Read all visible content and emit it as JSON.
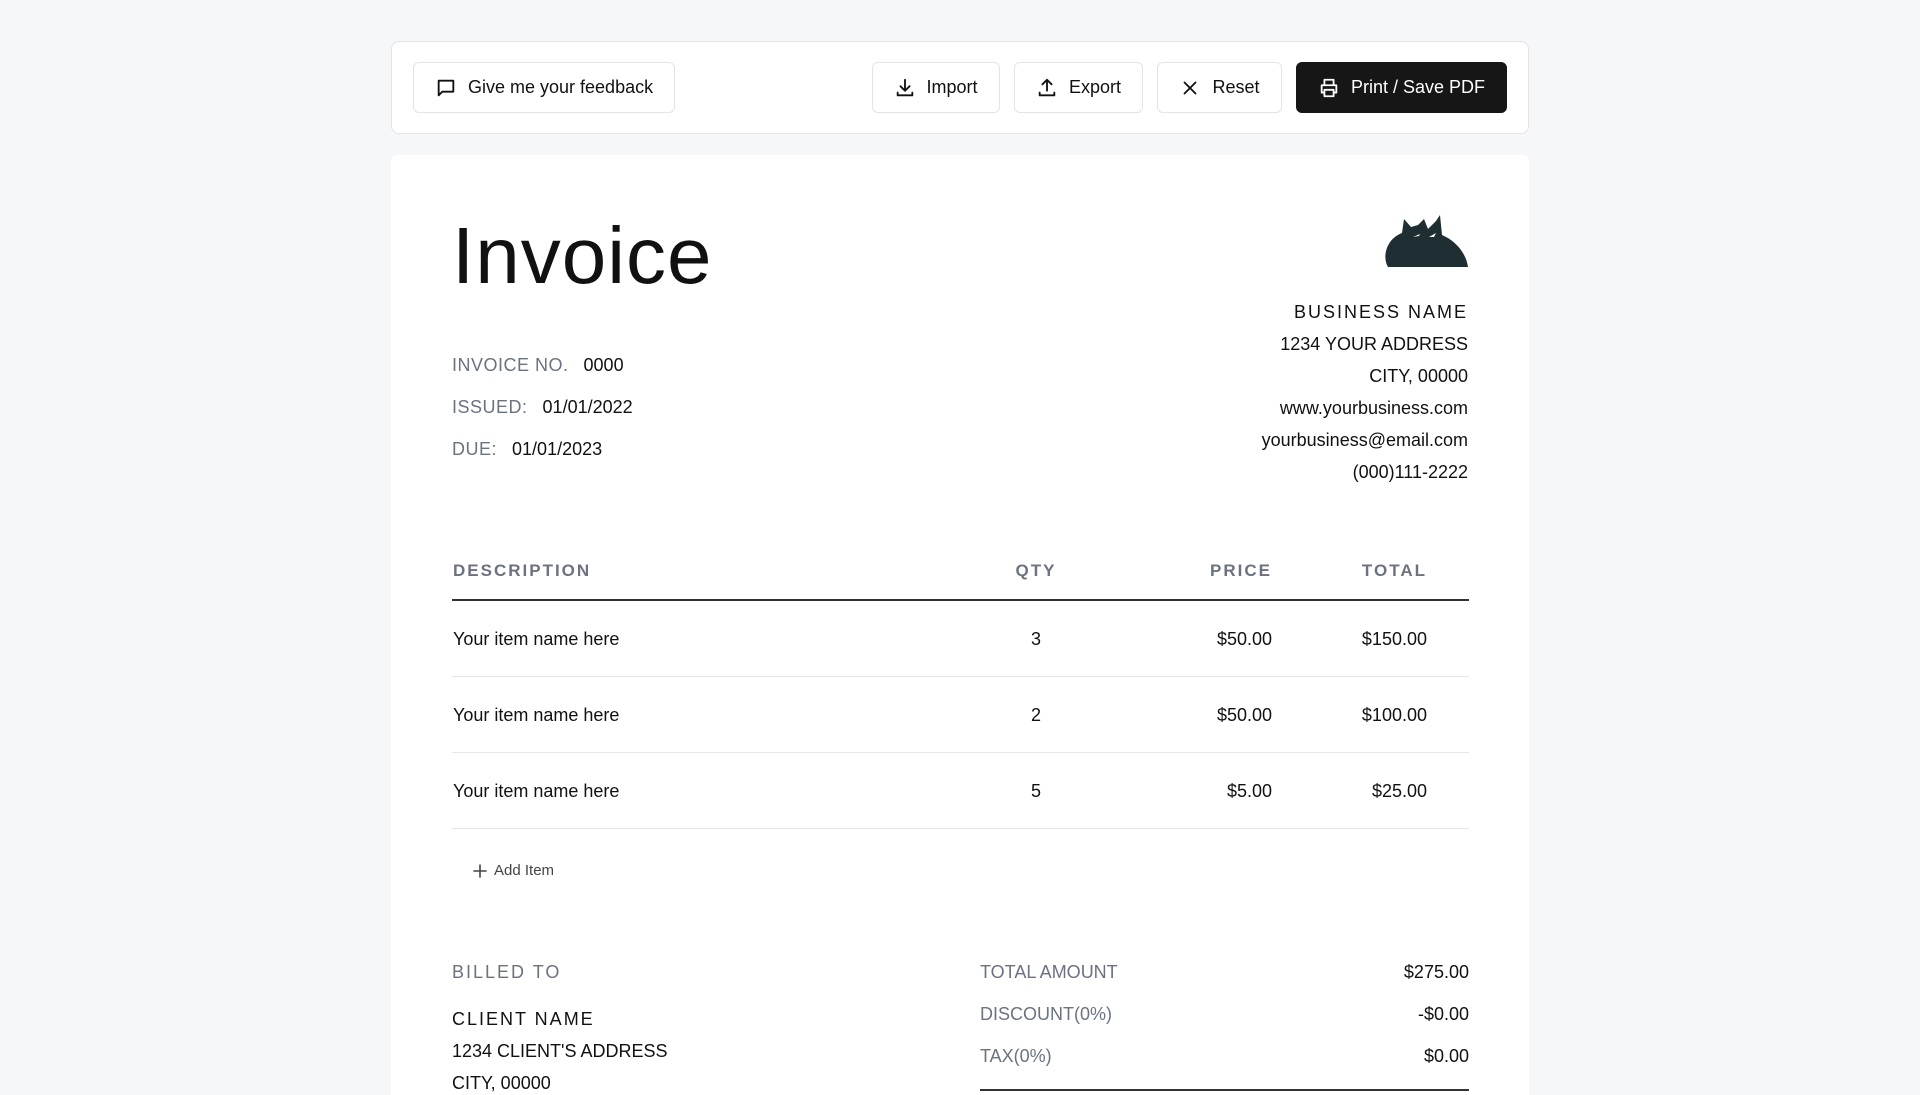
{
  "toolbar": {
    "feedback_label": "Give me your feedback",
    "import_label": "Import",
    "export_label": "Export",
    "reset_label": "Reset",
    "print_label": "Print / Save PDF"
  },
  "invoice": {
    "title": "Invoice",
    "number_label": "INVOICE NO.",
    "number": "0000",
    "issued_label": "ISSUED:",
    "issued": "01/01/2022",
    "due_label": "DUE:",
    "due": "01/01/2023"
  },
  "business": {
    "name": "BUSINESS NAME",
    "address": "1234 YOUR ADDRESS",
    "city": "CITY, 00000",
    "website": "www.yourbusiness.com",
    "email": "yourbusiness@email.com",
    "phone": "(000)111-2222"
  },
  "table": {
    "headers": {
      "description": "DESCRIPTION",
      "qty": "QTY",
      "price": "PRICE",
      "total": "TOTAL"
    },
    "rows": [
      {
        "description": "Your item name here",
        "qty": "3",
        "price": "$50.00",
        "total": "$150.00"
      },
      {
        "description": "Your item name here",
        "qty": "2",
        "price": "$50.00",
        "total": "$100.00"
      },
      {
        "description": "Your item name here",
        "qty": "5",
        "price": "$5.00",
        "total": "$25.00"
      }
    ],
    "add_item_label": "Add Item"
  },
  "billed_to": {
    "label": "BILLED TO",
    "name": "CLIENT NAME",
    "address": "1234 CLIENT'S ADDRESS",
    "city": "CITY, 00000"
  },
  "totals": {
    "total_amount_label": "TOTAL AMOUNT",
    "total_amount": "$275.00",
    "discount_label": "DISCOUNT(0%)",
    "discount": "-$0.00",
    "tax_label": "TAX(0%)",
    "tax": "$0.00"
  },
  "colors": {
    "background": "#f6f7f9",
    "primary_button": "#161616",
    "muted_text": "#6b7280",
    "logo": "#1f2e33"
  },
  "icons": [
    "message-square-icon",
    "download-icon",
    "upload-icon",
    "x-icon",
    "printer-icon",
    "plus-icon",
    "cat-logo"
  ]
}
